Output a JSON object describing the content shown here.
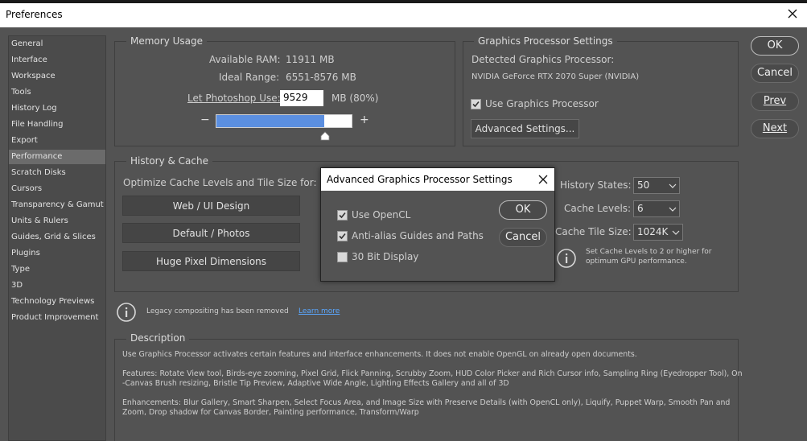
{
  "window": {
    "title": "Preferences"
  },
  "sidebar": {
    "items": [
      {
        "label": "General"
      },
      {
        "label": "Interface"
      },
      {
        "label": "Workspace"
      },
      {
        "label": "Tools"
      },
      {
        "label": "History Log"
      },
      {
        "label": "File Handling"
      },
      {
        "label": "Export"
      },
      {
        "label": "Performance",
        "selected": true
      },
      {
        "label": "Scratch Disks"
      },
      {
        "label": "Cursors"
      },
      {
        "label": "Transparency & Gamut"
      },
      {
        "label": "Units & Rulers"
      },
      {
        "label": "Guides, Grid & Slices"
      },
      {
        "label": "Plugins"
      },
      {
        "label": "Type"
      },
      {
        "label": "3D"
      },
      {
        "label": "Technology Previews"
      },
      {
        "label": "Product Improvement"
      }
    ]
  },
  "memory": {
    "legend": "Memory Usage",
    "available_label": "Available RAM:",
    "available_value": "11911 MB",
    "ideal_label": "Ideal Range:",
    "ideal_value": "6551-8576 MB",
    "use_label": "Let Photoshop Use:",
    "use_value": "9529",
    "use_unit": "MB (80%)",
    "minus": "−",
    "plus": "+",
    "slider_fraction": 0.8
  },
  "gpu": {
    "legend": "Graphics Processor Settings",
    "detected_label": "Detected Graphics Processor:",
    "detected_value": "NVIDIA GeForce RTX 2070 Super (NVIDIA)",
    "use_gpu_label": "Use Graphics Processor",
    "use_gpu_checked": true,
    "advanced_button": "Advanced Settings..."
  },
  "history": {
    "legend": "History & Cache",
    "optimize_label": "Optimize Cache Levels and Tile Size for:",
    "buttons": [
      "Web / UI Design",
      "Default / Photos",
      "Huge Pixel Dimensions"
    ],
    "states_label": "History States:",
    "states_value": "50",
    "cache_levels_label": "Cache Levels:",
    "cache_levels_value": "6",
    "tile_label": "Cache Tile Size:",
    "tile_value": "1024K",
    "note_line1": "Set Cache Levels to 2 or higher for",
    "note_line2": "optimum GPU performance."
  },
  "legacy": {
    "text": "Legacy compositing has been removed",
    "link": "Learn more"
  },
  "description": {
    "legend": "Description",
    "p1": "Use Graphics Processor activates certain features and interface enhancements. It does not enable OpenGL on already open documents.",
    "p2a": "Features: Rotate View tool, Birds-eye zooming, Pixel Grid, Flick Panning, Scrubby Zoom, HUD Color Picker and Rich Cursor info, Sampling Ring (Eyedropper Tool), On",
    "p2b": "-Canvas Brush resizing, Bristle Tip Preview, Adaptive Wide Angle, Lighting Effects Gallery and all of 3D",
    "p3a": "Enhancements: Blur Gallery, Smart Sharpen, Select Focus Area, and Image Size with Preserve Details (with OpenCL only), Liquify, Puppet Warp, Smooth Pan and",
    "p3b": "Zoom, Drop shadow for Canvas Border, Painting performance, Transform/Warp"
  },
  "actions": {
    "ok": "OK",
    "cancel": "Cancel",
    "prev": "Prev",
    "next": "Next"
  },
  "dialog": {
    "title": "Advanced Graphics Processor Settings",
    "options": [
      {
        "label": "Use OpenCL",
        "checked": true
      },
      {
        "label": "Anti-alias Guides and Paths",
        "checked": true
      },
      {
        "label": "30 Bit Display",
        "checked": false
      }
    ],
    "ok": "OK",
    "cancel": "Cancel"
  },
  "colors": {
    "background": "#535353",
    "slider_fill": "#5b8fe0",
    "link": "#5aa7ff"
  }
}
